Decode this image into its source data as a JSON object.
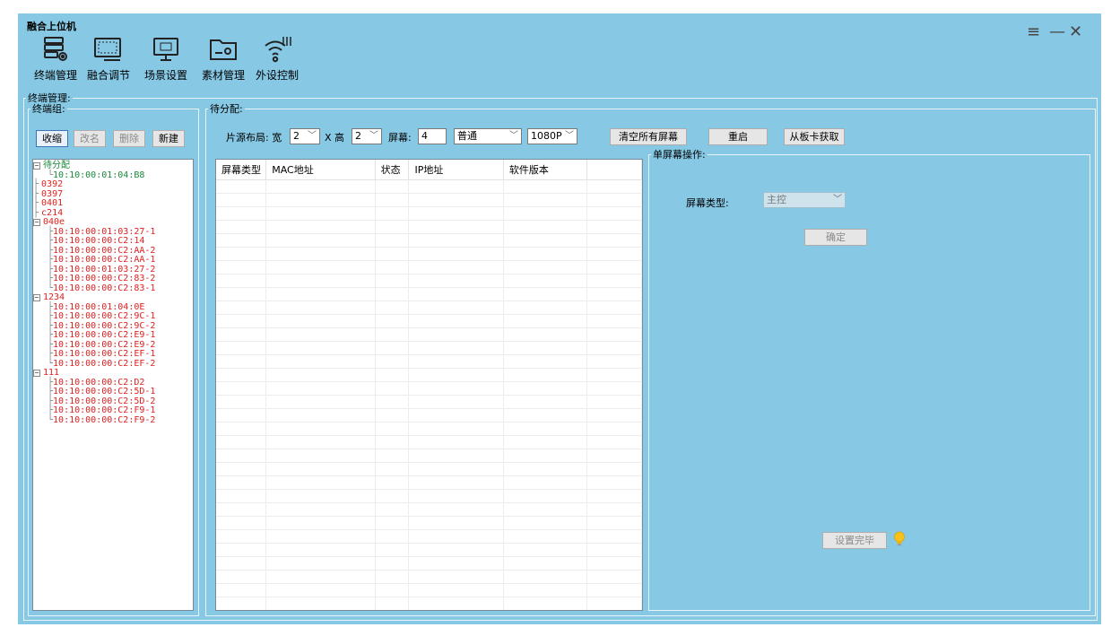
{
  "window": {
    "title": "融合上位机",
    "controls": {
      "menu": "≡",
      "minimize": "—",
      "close": "✕"
    }
  },
  "toolbar": [
    {
      "label": "终端管理",
      "icon": "terminal-management-icon"
    },
    {
      "label": "融合调节",
      "icon": "fusion-adjust-icon"
    },
    {
      "label": "场景设置",
      "icon": "scene-settings-icon"
    },
    {
      "label": "素材管理",
      "icon": "material-folder-icon"
    },
    {
      "label": "外设控制",
      "icon": "peripheral-control-icon"
    }
  ],
  "terminal_management": {
    "legend": "终端管理:",
    "group_panel": {
      "legend": "终端组:",
      "buttons": {
        "collapse": "收缩",
        "rename": "改名",
        "delete": "删除",
        "new": "新建"
      },
      "tree": [
        {
          "label": "待分配",
          "color": "green",
          "children": [
            "10:10:00:01:04:B8"
          ]
        },
        {
          "label": "0392",
          "color": "red",
          "children": []
        },
        {
          "label": "0397",
          "color": "red",
          "children": []
        },
        {
          "label": "0401",
          "color": "red",
          "children": []
        },
        {
          "label": "c214",
          "color": "red",
          "children": []
        },
        {
          "label": "040e",
          "color": "red",
          "children": [
            "10:10:00:01:03:27-1",
            "10:10:00:00:C2:14",
            "10:10:00:00:C2:AA-2",
            "10:10:00:00:C2:AA-1",
            "10:10:00:01:03:27-2",
            "10:10:00:00:C2:83-2",
            "10:10:00:00:C2:83-1"
          ]
        },
        {
          "label": "1234",
          "color": "red",
          "children": [
            "10:10:00:01:04:0E",
            "10:10:00:00:C2:9C-1",
            "10:10:00:00:C2:9C-2",
            "10:10:00:00:C2:E9-1",
            "10:10:00:00:C2:E9-2",
            "10:10:00:00:C2:EF-1",
            "10:10:00:00:C2:EF-2"
          ]
        },
        {
          "label": "111",
          "color": "red",
          "children": [
            "10:10:00:00:C2:D2",
            "10:10:00:00:C2:5D-1",
            "10:10:00:00:C2:5D-2",
            "10:10:00:00:C2:F9-1",
            "10:10:00:00:C2:F9-2"
          ]
        }
      ]
    },
    "assign_panel": {
      "legend": "待分配:",
      "layout_label": "片源布局: 宽",
      "width_value": "2",
      "x_label": "X 高",
      "height_value": "2",
      "screens_label": "屏幕:",
      "screens_value": "4",
      "mode_value": "普通",
      "resolution_value": "1080P",
      "buttons": {
        "clear_all": "清空所有屏幕",
        "restart": "重启",
        "fetch": "从板卡获取"
      },
      "table": {
        "columns": [
          "屏幕类型",
          "MAC地址",
          "状态",
          "IP地址",
          "软件版本",
          ""
        ],
        "rows": []
      },
      "single_screen": {
        "legend": "单屏幕操作:",
        "type_label": "屏幕类型:",
        "type_value": "主控",
        "confirm": "确定",
        "finish": "设置完毕"
      }
    }
  }
}
